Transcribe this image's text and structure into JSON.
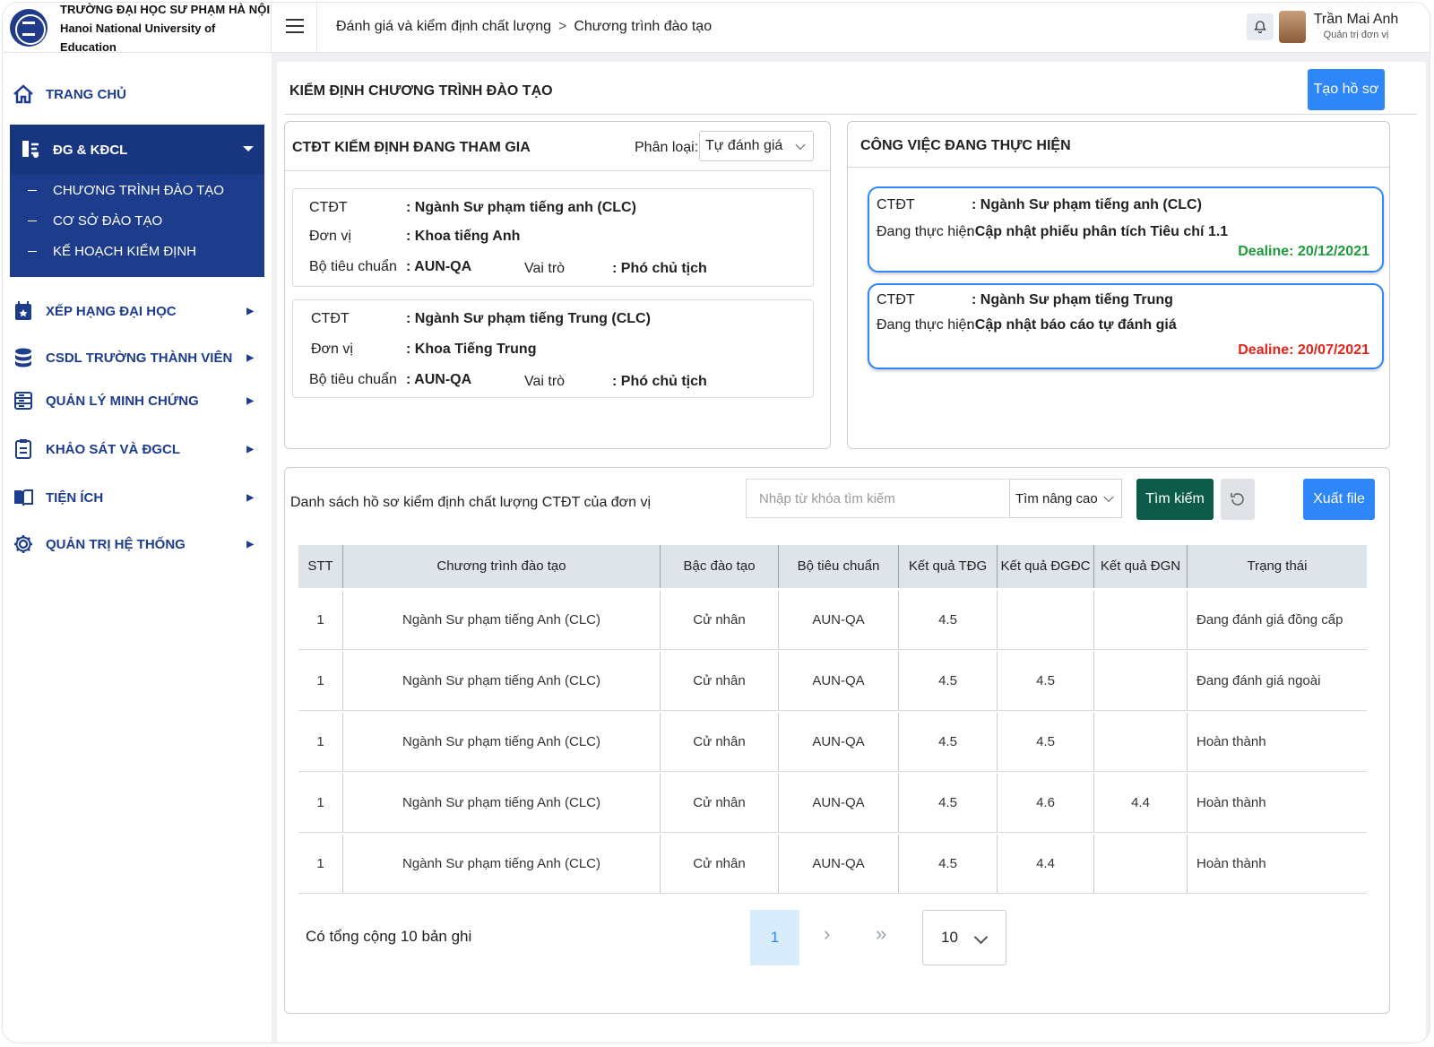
{
  "brand": {
    "line1": "TRƯỜNG ĐẠI HỌC SƯ PHẠM HÀ NỘI",
    "line2": "Hanoi National University of Education"
  },
  "breadcrumb": {
    "parent": "Đánh giá và kiểm định chất lượng",
    "separator": ">",
    "current": "Chương trình đào tạo"
  },
  "user": {
    "name": "Trần Mai Anh",
    "role": "Quản trị đơn vị"
  },
  "sidebar": {
    "home": "TRANG CHỦ",
    "active": {
      "label": "ĐG & KĐCL",
      "subitems": [
        "CHƯƠNG TRÌNH ĐÀO TẠO",
        "CƠ SỞ ĐÀO TẠO",
        "KẾ HOẠCH KIỂM ĐỊNH"
      ]
    },
    "items": [
      "XẾP HẠNG ĐẠI HỌC",
      "CSDL TRƯỜNG THÀNH VIÊN",
      "QUẢN LÝ MINH CHỨNG",
      "KHẢO SÁT VÀ ĐGCL",
      "TIỆN ÍCH",
      "QUẢN TRỊ HỆ THỐNG"
    ],
    "accent": "#1d3c8c"
  },
  "main": {
    "title": "KIỂM ĐỊNH CHƯƠNG TRÌNH ĐÀO TẠO",
    "create_button": "Tạo hồ sơ"
  },
  "programs_panel": {
    "title": "CTĐT KIỂM ĐỊNH ĐANG THAM GIA",
    "filter_label": "Phân loại:",
    "filter_value": "Tự đánh giá",
    "labels": {
      "program": "CTĐT",
      "unit": "Đơn vị",
      "standard": "Bộ tiêu chuẩn",
      "role": "Vai trò"
    },
    "cards": [
      {
        "program": ": Ngành Sư phạm tiếng anh (CLC)",
        "unit": ": Khoa tiếng  Anh",
        "standard": ": AUN-QA",
        "role": ": Phó chủ tịch"
      },
      {
        "program": ": Ngành Sư phạm tiếng Trung (CLC)",
        "unit": ": Khoa Tiếng Trung",
        "standard": ": AUN-QA",
        "role": ": Phó chủ tịch"
      }
    ]
  },
  "tasks_panel": {
    "title": "CÔNG VIỆC ĐANG THỰC HIỆN",
    "labels": {
      "program": "CTĐT",
      "doing": "Đang thực hiện"
    },
    "tasks": [
      {
        "program": ": Ngành Sư phạm tiếng anh (CLC)",
        "doing": ": Cập nhật phiếu phân tích Tiêu chí 1.1",
        "deadline": "Dealine: 20/12/2021",
        "deadline_color": "#1e9a3c"
      },
      {
        "program": ": Ngành Sư phạm tiếng Trung",
        "doing": ": Cập nhật báo cáo tự đánh giá",
        "deadline": "Dealine: 20/07/2021",
        "deadline_color": "#e2231a"
      }
    ]
  },
  "list": {
    "title": "Danh sách hồ sơ kiểm định chất lượng CTĐT của đơn vị",
    "search_placeholder": "Nhập từ khóa tìm kiếm",
    "advanced": "Tìm nâng cao",
    "search_button": "Tìm kiếm",
    "reset_icon": "refresh-icon",
    "export_button": "Xuất file",
    "columns": [
      "STT",
      "Chương trình đào tạo",
      "Bậc đào tạo",
      "Bộ tiêu chuẩn",
      "Kết quả TĐG",
      "Kết quả ĐGĐC",
      "Kết quả ĐGN",
      "Trạng thái"
    ],
    "rows": [
      [
        "1",
        "Ngành Sư phạm tiếng Anh (CLC)",
        "Cử nhân",
        "AUN-QA",
        "4.5",
        "",
        "",
        "Đang  đánh giá đồng cấp"
      ],
      [
        "1",
        "Ngành Sư phạm tiếng Anh (CLC)",
        "Cử nhân",
        "AUN-QA",
        "4.5",
        "4.5",
        "",
        "Đang đánh giá ngoài"
      ],
      [
        "1",
        "Ngành Sư phạm tiếng Anh (CLC)",
        "Cử nhân",
        "AUN-QA",
        "4.5",
        "4.5",
        "",
        "Hoàn thành"
      ],
      [
        "1",
        "Ngành Sư phạm tiếng Anh (CLC)",
        "Cử nhân",
        "AUN-QA",
        "4.5",
        "4.6",
        "4.4",
        "Hoàn thành"
      ],
      [
        "1",
        "Ngành Sư phạm tiếng Anh (CLC)",
        "Cử nhân",
        "AUN-QA",
        "4.5",
        "4.4",
        "",
        "Hoàn thành"
      ]
    ],
    "total": "Có tổng cộng 10 bản ghi",
    "current_page": "1",
    "next": "›",
    "last": "»",
    "page_size": "10"
  },
  "colors": {
    "primary": "#2f86f6",
    "search_button": "#0d5b49",
    "sidebar_active": "#1d3c8c"
  }
}
